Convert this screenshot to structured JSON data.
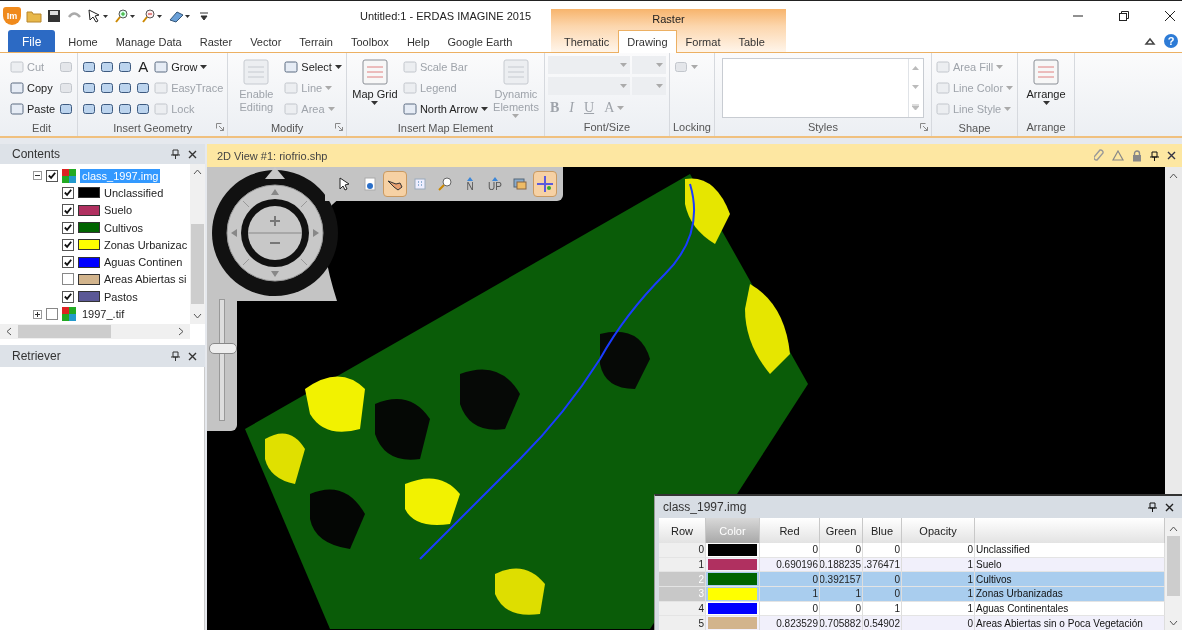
{
  "app_logo": "Im",
  "window": {
    "title": "Untitled:1 - ERDAS IMAGINE 2015",
    "context_group": "Raster",
    "help": "?"
  },
  "tabs": [
    {
      "label": "File",
      "kind": "file",
      "selected": false
    },
    {
      "label": "Home",
      "kind": "normal",
      "selected": false
    },
    {
      "label": "Manage Data",
      "kind": "normal",
      "selected": false
    },
    {
      "label": "Raster",
      "kind": "normal",
      "selected": false
    },
    {
      "label": "Vector",
      "kind": "normal",
      "selected": false
    },
    {
      "label": "Terrain",
      "kind": "normal",
      "selected": false
    },
    {
      "label": "Toolbox",
      "kind": "normal",
      "selected": false
    },
    {
      "label": "Help",
      "kind": "normal",
      "selected": false
    },
    {
      "label": "Google Earth",
      "kind": "normal",
      "selected": false
    },
    {
      "label": "Thematic",
      "kind": "context",
      "selected": false
    },
    {
      "label": "Drawing",
      "kind": "context",
      "selected": true
    },
    {
      "label": "Format",
      "kind": "context",
      "selected": false
    },
    {
      "label": "Table",
      "kind": "context",
      "selected": false
    }
  ],
  "ribbon": [
    {
      "label": "Edit",
      "kind": "tools",
      "launcher": false,
      "columns": [
        [
          {
            "label": "Cut",
            "disabled": true
          },
          {
            "label": "Copy",
            "disabled": false
          },
          {
            "label": "Paste",
            "disabled": false
          }
        ],
        [
          {
            "disabled": true
          },
          {
            "disabled": true
          },
          {
            "disabled": false
          }
        ]
      ]
    },
    {
      "label": "Insert Geometry",
      "kind": "tools",
      "launcher": true,
      "columns": [
        [
          {
            "disabled": false
          },
          {
            "disabled": false
          },
          {
            "disabled": false
          }
        ],
        [
          {
            "disabled": false
          },
          {
            "disabled": false
          },
          {
            "disabled": false
          }
        ],
        [
          {
            "disabled": false
          },
          {
            "disabled": false
          },
          {
            "disabled": false
          }
        ],
        [
          {
            "glyph": "A",
            "disabled": false
          },
          {
            "disabled": false
          },
          {
            "disabled": false
          }
        ],
        [
          {
            "label": "Grow",
            "dropdown": true,
            "disabled": false
          },
          {
            "label": "EasyTrace",
            "disabled": true
          },
          {
            "label": "Lock",
            "disabled": true
          }
        ]
      ]
    },
    {
      "label": "Modify",
      "kind": "tools",
      "launcher": true,
      "columns": [
        [
          {
            "label": "Enable Editing",
            "large": true,
            "disabled": true
          }
        ],
        [
          {
            "label": "Select",
            "dropdown": true,
            "disabled": false
          },
          {
            "label": "Line",
            "dropdown": true,
            "disabled": true
          },
          {
            "label": "Area",
            "dropdown": true,
            "disabled": true
          }
        ]
      ]
    },
    {
      "label": "Insert Map Element",
      "kind": "tools",
      "launcher": false,
      "columns": [
        [
          {
            "label": "Map Grid",
            "large": true,
            "dropdown": true,
            "disabled": false
          }
        ],
        [
          {
            "label": "Scale Bar",
            "disabled": true
          },
          {
            "label": "Legend",
            "disabled": true
          },
          {
            "label": "North Arrow",
            "dropdown": true,
            "disabled": false
          }
        ],
        [
          {
            "label": "Dynamic Elements",
            "large": true,
            "dropdown": true,
            "disabled": true
          }
        ]
      ]
    },
    {
      "label": "Font/Size",
      "kind": "font",
      "launcher": false,
      "buttons": [
        {
          "glyph": "B",
          "disabled": true
        },
        {
          "glyph": "I",
          "disabled": true
        },
        {
          "glyph": "U",
          "disabled": true
        },
        {
          "glyph": "A",
          "dropdown": true,
          "disabled": true
        }
      ]
    },
    {
      "label": "Locking",
      "kind": "tools",
      "launcher": false,
      "columns": [
        [
          {
            "dropdown": true,
            "disabled": true
          }
        ]
      ]
    },
    {
      "label": "Styles",
      "kind": "gallery",
      "launcher": true
    },
    {
      "label": "Shape",
      "kind": "tools",
      "launcher": false,
      "columns": [
        [
          {
            "label": "Area Fill",
            "dropdown": true,
            "disabled": true
          },
          {
            "label": "Line  Color",
            "dropdown": true,
            "disabled": true
          },
          {
            "label": "Line Style",
            "dropdown": true,
            "disabled": true
          }
        ]
      ]
    },
    {
      "label": "Arrange",
      "kind": "tools",
      "launcher": false,
      "columns": [
        [
          {
            "label": "Arrange",
            "large": true,
            "dropdown": true,
            "disabled": false
          }
        ]
      ]
    }
  ],
  "contents": {
    "title": "Contents",
    "layers": [
      {
        "name": "class_1997.img",
        "checked": true,
        "expanded": true,
        "selected": true,
        "children": [
          {
            "name": "Unclassified",
            "checked": true,
            "color": "#000000"
          },
          {
            "name": "Suelo",
            "checked": true,
            "color": "#b03060"
          },
          {
            "name": "Cultivos",
            "checked": true,
            "color": "#006400"
          },
          {
            "name": "Zonas Urbanizac",
            "checked": true,
            "color": "#ffff00"
          },
          {
            "name": "Aguas Continen",
            "checked": true,
            "color": "#0000ff"
          },
          {
            "name": "Areas Abiertas si",
            "checked": false,
            "color": "#d2b48c"
          },
          {
            "name": "Pastos",
            "checked": true,
            "color": "#5b5896"
          }
        ]
      },
      {
        "name": "1997_.tif",
        "checked": false,
        "expanded": false,
        "selected": false
      }
    ]
  },
  "retriever": {
    "title": "Retriever"
  },
  "view": {
    "title": "2D View #1: riofrio.shp",
    "tools": [
      {
        "kind": "pointer",
        "selected": false
      },
      {
        "kind": "info",
        "selected": false
      },
      {
        "kind": "pan",
        "selected": true
      },
      {
        "kind": "fit",
        "selected": false
      },
      {
        "kind": "zoom",
        "selected": false
      },
      {
        "kind": "north",
        "glyph": "N",
        "selected": false
      },
      {
        "kind": "up",
        "glyph": "UP",
        "selected": false
      },
      {
        "kind": "layers",
        "selected": false
      },
      {
        "kind": "inquire",
        "selected": true
      }
    ],
    "zoom_slider": {
      "level": 0.58
    }
  },
  "table": {
    "title": "class_1997.img",
    "columns": [
      {
        "label": "Row",
        "selected": false
      },
      {
        "label": "Color",
        "selected": true
      },
      {
        "label": "Red",
        "selected": false
      },
      {
        "label": "Green",
        "selected": false
      },
      {
        "label": "Blue",
        "selected": false
      },
      {
        "label": "Opacity",
        "selected": false
      }
    ],
    "rows": [
      {
        "row": "0",
        "color": "#000000",
        "red": "0",
        "green": "0",
        "blue": "0",
        "opacity": "0",
        "class_name": "Unclassified",
        "selected": false
      },
      {
        "row": "1",
        "color": "#b03060",
        "red": "0.690196",
        "green": "0.188235",
        "blue": ".376471",
        "opacity": "1",
        "class_name": "Suelo",
        "selected": false
      },
      {
        "row": "2",
        "color": "#006400",
        "red": "0",
        "green": "0.392157",
        "blue": "0",
        "opacity": "1",
        "class_name": "Cultivos",
        "selected": true
      },
      {
        "row": "3",
        "color": "#ffff00",
        "red": "1",
        "green": "1",
        "blue": "0",
        "opacity": "1",
        "class_name": "Zonas Urbanizadas",
        "selected": true
      },
      {
        "row": "4",
        "color": "#0000ff",
        "red": "0",
        "green": "0",
        "blue": "1",
        "opacity": "1",
        "class_name": "Aguas Continentales",
        "selected": false
      },
      {
        "row": "5",
        "color": "#d2b48c",
        "red": "0.823529",
        "green": "0.705882",
        "blue": "0.54902",
        "opacity": "0",
        "class_name": "Areas Abiertas sin o Poca Vegetación",
        "selected": false
      }
    ]
  }
}
